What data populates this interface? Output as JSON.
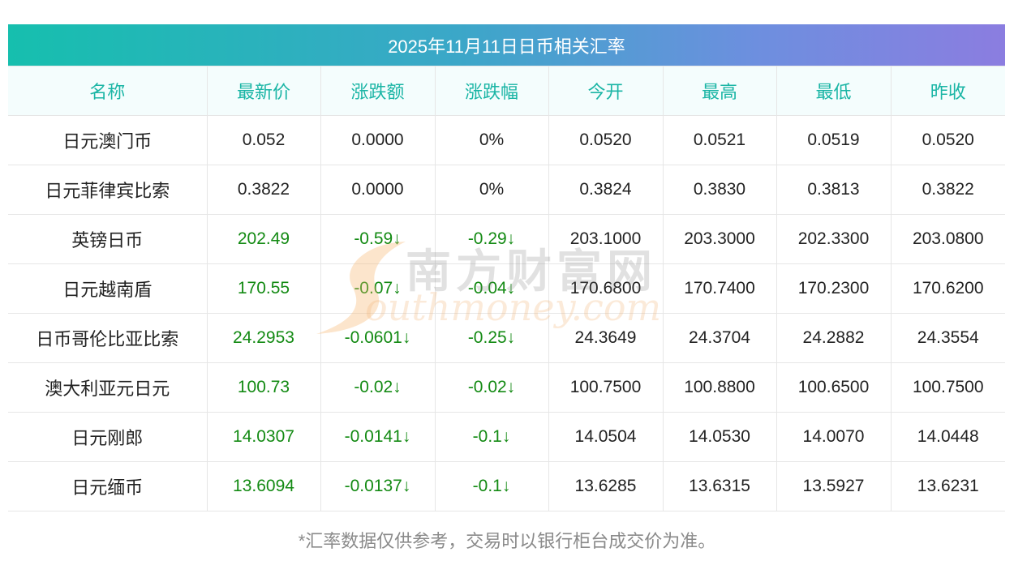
{
  "title": "2025年11月11日日币相关汇率",
  "headers": [
    "名称",
    "最新价",
    "涨跌额",
    "涨跌幅",
    "今开",
    "最高",
    "最低",
    "昨收"
  ],
  "rows": [
    {
      "name": "日元澳门币",
      "latest": "0.052",
      "change": "0.0000",
      "pct": "0%",
      "open": "0.0520",
      "high": "0.0521",
      "low": "0.0519",
      "prev": "0.0520",
      "trend": "flat"
    },
    {
      "name": "日元菲律宾比索",
      "latest": "0.3822",
      "change": "0.0000",
      "pct": "0%",
      "open": "0.3824",
      "high": "0.3830",
      "low": "0.3813",
      "prev": "0.3822",
      "trend": "flat"
    },
    {
      "name": "英镑日币",
      "latest": "202.49",
      "change": "-0.59↓",
      "pct": "-0.29↓",
      "open": "203.1000",
      "high": "203.3000",
      "low": "202.3300",
      "prev": "203.0800",
      "trend": "down"
    },
    {
      "name": "日元越南盾",
      "latest": "170.55",
      "change": "-0.07↓",
      "pct": "-0.04↓",
      "open": "170.6800",
      "high": "170.7400",
      "low": "170.2300",
      "prev": "170.6200",
      "trend": "down"
    },
    {
      "name": "日币哥伦比亚比索",
      "latest": "24.2953",
      "change": "-0.0601↓",
      "pct": "-0.25↓",
      "open": "24.3649",
      "high": "24.3704",
      "low": "24.2882",
      "prev": "24.3554",
      "trend": "down"
    },
    {
      "name": "澳大利亚元日元",
      "latest": "100.73",
      "change": "-0.02↓",
      "pct": "-0.02↓",
      "open": "100.7500",
      "high": "100.8800",
      "low": "100.6500",
      "prev": "100.7500",
      "trend": "down"
    },
    {
      "name": "日元刚郎",
      "latest": "14.0307",
      "change": "-0.0141↓",
      "pct": "-0.1↓",
      "open": "14.0504",
      "high": "14.0530",
      "low": "14.0070",
      "prev": "14.0448",
      "trend": "down"
    },
    {
      "name": "日元缅币",
      "latest": "13.6094",
      "change": "-0.0137↓",
      "pct": "-0.1↓",
      "open": "13.6285",
      "high": "13.6315",
      "low": "13.5927",
      "prev": "13.6231",
      "trend": "down"
    }
  ],
  "note": "*汇率数据仅供参考，交易时以银行柜台成交价为准。",
  "watermark": {
    "cn": "南方财富网",
    "en": "outhmoney.com"
  },
  "colors": {
    "header_text": "#1ab5a5",
    "down": "#138a13",
    "title_gradient_start": "#16bfae",
    "title_gradient_end": "#8b7de0"
  }
}
